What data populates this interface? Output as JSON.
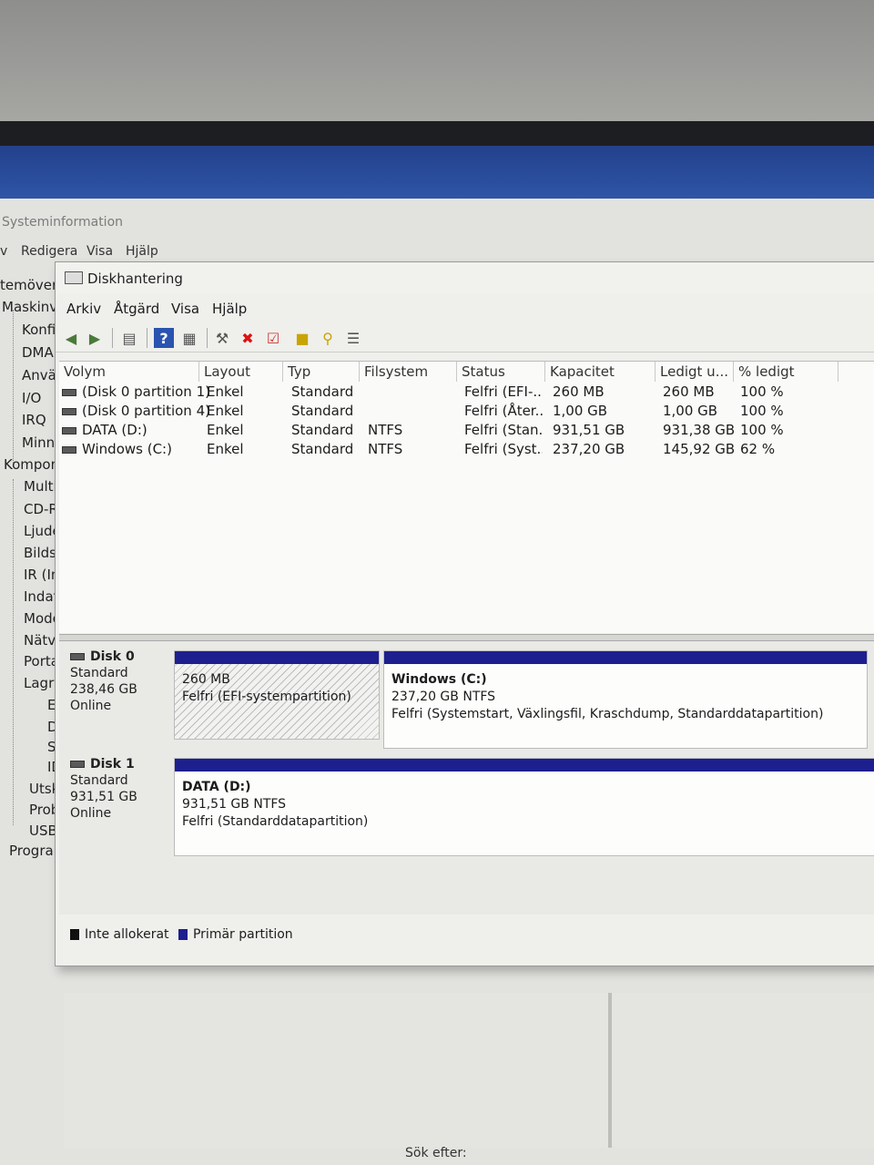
{
  "background_window": {
    "title": "Systeminformation",
    "menu": [
      "v",
      "Redigera",
      "Visa",
      "Hjälp"
    ],
    "tree": [
      "temöver",
      "Maskinv",
      "Konfi",
      "DMA",
      "Anväi",
      "I/O",
      "IRQ",
      "Minn",
      "Kompon",
      "Multi",
      "CD-R",
      "Ljude",
      "Bildsl",
      "IR (In",
      "Indat",
      "Mode",
      "Nätve",
      "Porta",
      "Lagri",
      "Er",
      "Di",
      "SC",
      "ID",
      "Utskr",
      "Probl",
      "USB",
      "Program"
    ],
    "search_label": "Sök efter:"
  },
  "disk_management": {
    "title": "Diskhantering",
    "menu": [
      "Arkiv",
      "Åtgärd",
      "Visa",
      "Hjälp"
    ],
    "toolbar_icons": [
      "back-icon",
      "forward-icon",
      "list-view-icon",
      "help-icon",
      "properties-icon",
      "connect-icon",
      "delete-icon",
      "check-icon",
      "folder-up-icon",
      "search-folder-icon",
      "settings-list-icon"
    ],
    "columns": [
      "Volym",
      "Layout",
      "Typ",
      "Filsystem",
      "Status",
      "Kapacitet",
      "Ledigt u...",
      "% ledigt"
    ],
    "volumes": [
      {
        "volym": "(Disk 0 partition 1)",
        "layout": "Enkel",
        "typ": "Standard",
        "filsystem": "",
        "status": "Felfri (EFI-...",
        "kapacitet": "260 MB",
        "ledigt": "260 MB",
        "procent": "100 %"
      },
      {
        "volym": "(Disk 0 partition 4)",
        "layout": "Enkel",
        "typ": "Standard",
        "filsystem": "",
        "status": "Felfri (Åter...",
        "kapacitet": "1,00 GB",
        "ledigt": "1,00 GB",
        "procent": "100 %"
      },
      {
        "volym": "DATA (D:)",
        "layout": "Enkel",
        "typ": "Standard",
        "filsystem": "NTFS",
        "status": "Felfri (Stan...",
        "kapacitet": "931,51 GB",
        "ledigt": "931,38 GB",
        "procent": "100 %"
      },
      {
        "volym": "Windows (C:)",
        "layout": "Enkel",
        "typ": "Standard",
        "filsystem": "NTFS",
        "status": "Felfri (Syst...",
        "kapacitet": "237,20 GB",
        "ledigt": "145,92 GB",
        "procent": "62 %"
      }
    ],
    "disks": [
      {
        "name": "Disk 0",
        "type": "Standard",
        "size": "238,46 GB",
        "state": "Online",
        "partitions": [
          {
            "title": "",
            "size": "260 MB",
            "status": "Felfri (EFI-systempartition)"
          },
          {
            "title": "Windows  (C:)",
            "size": "237,20 GB NTFS",
            "status": "Felfri (Systemstart, Växlingsfil, Kraschdump, Standarddatapartition)"
          }
        ]
      },
      {
        "name": "Disk 1",
        "type": "Standard",
        "size": "931,51 GB",
        "state": "Online",
        "partitions": [
          {
            "title": "DATA  (D:)",
            "size": "931,51 GB NTFS",
            "status": "Felfri (Standarddatapartition)"
          }
        ]
      }
    ],
    "legend": [
      {
        "label": "Inte allokerat",
        "color": "#111111"
      },
      {
        "label": "Primär partition",
        "color": "#1d1f8f"
      }
    ]
  }
}
